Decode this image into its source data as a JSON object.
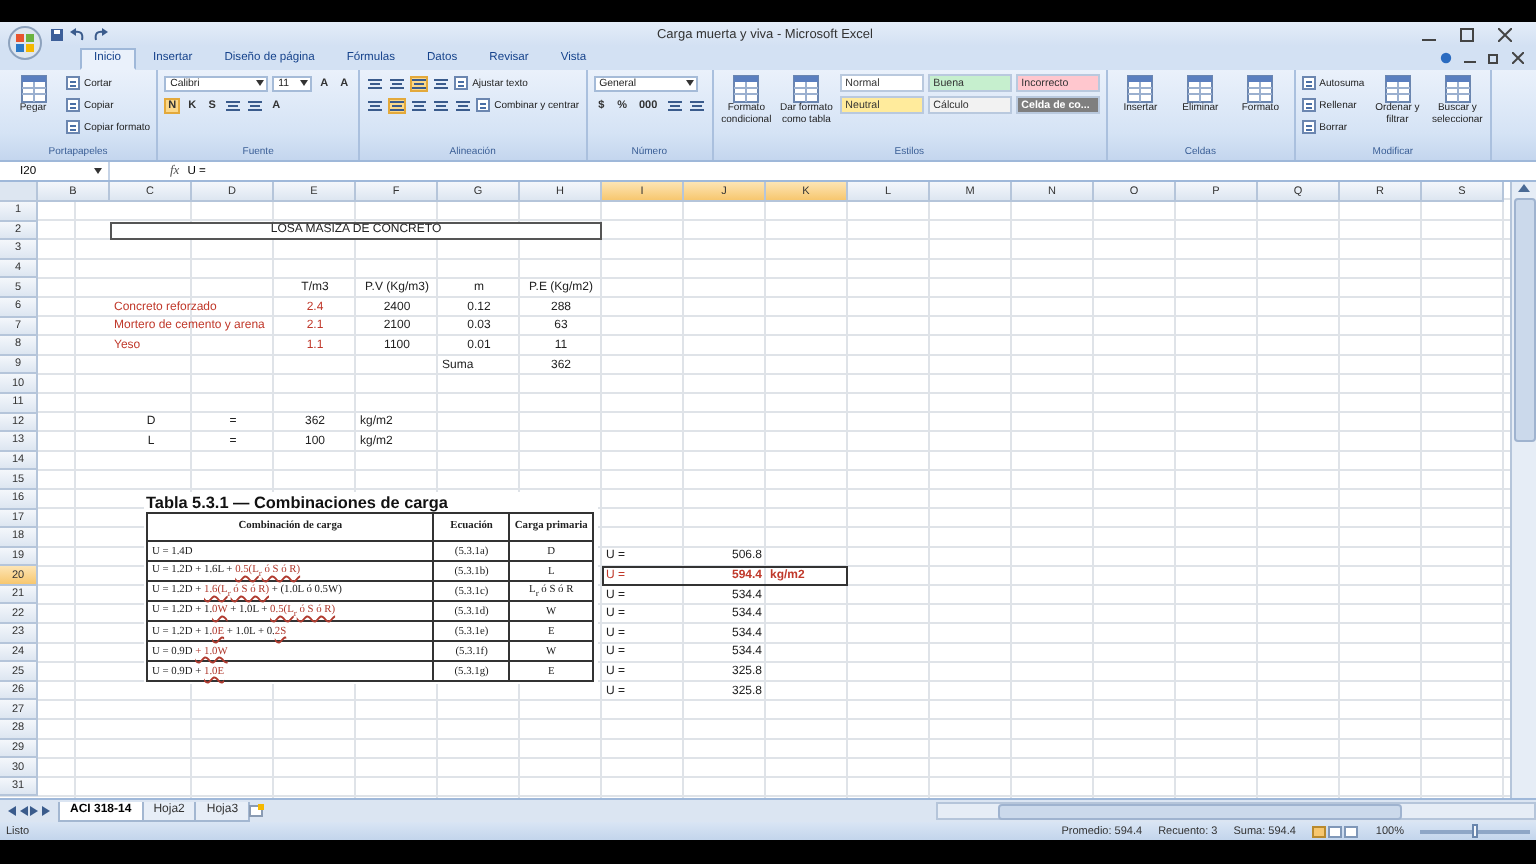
{
  "window": {
    "title": "Carga muerta y viva - Microsoft Excel"
  },
  "tabs": [
    {
      "label": "Inicio",
      "selected": true
    },
    {
      "label": "Insertar",
      "selected": false
    },
    {
      "label": "Diseño de página",
      "selected": false
    },
    {
      "label": "Fórmulas",
      "selected": false
    },
    {
      "label": "Datos",
      "selected": false
    },
    {
      "label": "Revisar",
      "selected": false
    },
    {
      "label": "Vista",
      "selected": false
    }
  ],
  "ribbon": [
    {
      "label": "Portapapeles",
      "blocks": [
        {
          "kind": "large",
          "label": "Pegar"
        },
        {
          "kind": "stack",
          "lines": [
            [
              {
                "kind": "small",
                "label": "Cortar"
              }
            ],
            [
              {
                "kind": "small",
                "label": "Copiar"
              }
            ],
            [
              {
                "kind": "small",
                "label": "Copiar formato"
              }
            ]
          ]
        }
      ]
    },
    {
      "label": "Fuente",
      "blocks": [
        {
          "kind": "stack",
          "lines": [
            [
              {
                "kind": "field",
                "value": "Calibri"
              },
              {
                "kind": "field",
                "value": "11"
              },
              {
                "kind": "glyph",
                "label": "A",
                "on": false
              },
              {
                "kind": "glyph",
                "label": "A",
                "on": false
              }
            ],
            [
              {
                "kind": "glyph",
                "label": "N",
                "on": true
              },
              {
                "kind": "glyph",
                "label": "K",
                "on": false
              },
              {
                "kind": "glyph",
                "label": "S",
                "on": false
              },
              {
                "kind": "icon",
                "on": false
              },
              {
                "kind": "icon",
                "on": false
              },
              {
                "kind": "glyph",
                "label": "A",
                "on": false
              }
            ]
          ]
        }
      ]
    },
    {
      "label": "Alineación",
      "blocks": [
        {
          "kind": "stack",
          "lines": [
            [
              {
                "kind": "icon",
                "on": false
              },
              {
                "kind": "icon",
                "on": false
              },
              {
                "kind": "icon",
                "on": true
              },
              {
                "kind": "icon",
                "on": false
              },
              {
                "kind": "small",
                "label": "Ajustar texto"
              }
            ],
            [
              {
                "kind": "icon",
                "on": false
              },
              {
                "kind": "icon",
                "on": true
              },
              {
                "kind": "icon",
                "on": false
              },
              {
                "kind": "icon",
                "on": false
              },
              {
                "kind": "icon",
                "on": false
              },
              {
                "kind": "small",
                "label": "Combinar y centrar"
              }
            ]
          ]
        }
      ]
    },
    {
      "label": "Número",
      "blocks": [
        {
          "kind": "stack",
          "lines": [
            [
              {
                "kind": "field",
                "value": "General"
              }
            ],
            [
              {
                "kind": "glyph",
                "label": "$",
                "on": false
              },
              {
                "kind": "glyph",
                "label": "%",
                "on": false
              },
              {
                "kind": "glyph",
                "label": "000",
                "on": false
              },
              {
                "kind": "icon",
                "on": false
              },
              {
                "kind": "icon",
                "on": false
              }
            ]
          ]
        }
      ]
    },
    {
      "label": "Estilos",
      "blocks": [
        {
          "kind": "large",
          "label": "Formato condicional"
        },
        {
          "kind": "large",
          "label": "Dar formato como tabla"
        },
        {
          "kind": "stack",
          "lines": [
            [
              {
                "kind": "style",
                "label": "Normal",
                "color": "#ffffff"
              },
              {
                "kind": "style",
                "label": "Buena",
                "color": "#c6efce"
              },
              {
                "kind": "style",
                "label": "Incorrecto",
                "color": "#ffc7ce"
              }
            ],
            [
              {
                "kind": "style",
                "label": "Neutral",
                "color": "#ffeb9c"
              },
              {
                "kind": "style",
                "label": "Cálculo",
                "color": "#f2f2f2"
              },
              {
                "kind": "style",
                "label": "Celda de co...",
                "color": "#7f7f7f"
              }
            ]
          ]
        }
      ]
    },
    {
      "label": "Celdas",
      "blocks": [
        {
          "kind": "large",
          "label": "Insertar"
        },
        {
          "kind": "large",
          "label": "Eliminar"
        },
        {
          "kind": "large",
          "label": "Formato"
        }
      ]
    },
    {
      "label": "Modificar",
      "blocks": [
        {
          "kind": "stack",
          "lines": [
            [
              {
                "kind": "small",
                "label": "Autosuma"
              }
            ],
            [
              {
                "kind": "small",
                "label": "Rellenar"
              }
            ],
            [
              {
                "kind": "small",
                "label": "Borrar"
              }
            ]
          ]
        },
        {
          "kind": "large",
          "label": "Ordenar y filtrar"
        },
        {
          "kind": "large",
          "label": "Buscar y seleccionar"
        }
      ]
    }
  ],
  "formula_bar": {
    "cell": "I20",
    "function_label": "fx",
    "formula": "U ="
  },
  "columns": [
    {
      "letter": "B",
      "selected": false
    },
    {
      "letter": "C",
      "selected": false
    },
    {
      "letter": "D",
      "selected": false
    },
    {
      "letter": "E",
      "selected": false
    },
    {
      "letter": "F",
      "selected": false
    },
    {
      "letter": "G",
      "selected": false
    },
    {
      "letter": "H",
      "selected": false
    },
    {
      "letter": "I",
      "selected": true
    },
    {
      "letter": "J",
      "selected": true
    },
    {
      "letter": "K",
      "selected": true
    },
    {
      "letter": "L",
      "selected": false
    },
    {
      "letter": "M",
      "selected": false
    },
    {
      "letter": "N",
      "selected": false
    },
    {
      "letter": "O",
      "selected": false
    },
    {
      "letter": "P",
      "selected": false
    },
    {
      "letter": "Q",
      "selected": false
    },
    {
      "letter": "R",
      "selected": false
    },
    {
      "letter": "S",
      "selected": false
    }
  ],
  "rows": [
    {
      "number": "1",
      "selected": false
    },
    {
      "number": "2",
      "selected": false,
      "cells": [
        "",
        {
          "value": "LOSA MASIZA DE CONCRETO",
          "kind": "title",
          "colspan": 6,
          "selected": false,
          "bold": false
        }
      ]
    },
    {
      "number": "3",
      "selected": false
    },
    {
      "number": "4",
      "selected": false
    },
    {
      "number": "5",
      "selected": false,
      "cells": [
        "",
        "",
        "",
        {
          "value": "T/m3",
          "kind": "value",
          "selected": false,
          "bold": false
        },
        {
          "value": "P.V (Kg/m3)",
          "kind": "value",
          "selected": false,
          "bold": false
        },
        {
          "value": "m",
          "kind": "value",
          "selected": false,
          "bold": false
        },
        {
          "value": "P.E (Kg/m2)",
          "kind": "value",
          "selected": false,
          "bold": false
        }
      ]
    },
    {
      "number": "6",
      "selected": false,
      "cells": [
        "",
        {
          "value": "Concreto reforzado",
          "kind": "label",
          "color": "#c0392b",
          "selected": false,
          "bold": false
        },
        "",
        {
          "value": "2.4",
          "kind": "value",
          "color": "#c0392b",
          "selected": false,
          "bold": false
        },
        {
          "value": "2400",
          "kind": "value",
          "selected": false,
          "bold": false
        },
        {
          "value": "0.12",
          "kind": "value",
          "selected": false,
          "bold": false
        },
        {
          "value": "288",
          "kind": "value",
          "selected": false,
          "bold": false
        }
      ]
    },
    {
      "number": "7",
      "selected": false,
      "cells": [
        "",
        {
          "value": "Mortero de cemento y arena",
          "kind": "label",
          "color": "#c0392b",
          "selected": false,
          "bold": false
        },
        "",
        {
          "value": "2.1",
          "kind": "value",
          "color": "#c0392b",
          "selected": false,
          "bold": false
        },
        {
          "value": "2100",
          "kind": "value",
          "selected": false,
          "bold": false
        },
        {
          "value": "0.03",
          "kind": "value",
          "selected": false,
          "bold": false
        },
        {
          "value": "63",
          "kind": "value",
          "selected": false,
          "bold": false
        }
      ]
    },
    {
      "number": "8",
      "selected": false,
      "cells": [
        "",
        {
          "value": "Yeso",
          "kind": "label",
          "color": "#c0392b",
          "selected": false,
          "bold": false
        },
        "",
        {
          "value": "1.1",
          "kind": "value",
          "color": "#c0392b",
          "selected": false,
          "bold": false
        },
        {
          "value": "1100",
          "kind": "value",
          "selected": false,
          "bold": false
        },
        {
          "value": "0.01",
          "kind": "value",
          "selected": false,
          "bold": false
        },
        {
          "value": "11",
          "kind": "value",
          "selected": false,
          "bold": false
        }
      ]
    },
    {
      "number": "9",
      "selected": false,
      "cells": [
        "",
        "",
        "",
        "",
        "",
        {
          "value": "Suma",
          "kind": "label",
          "selected": false,
          "bold": false
        },
        {
          "value": "362",
          "kind": "value",
          "selected": false,
          "bold": false
        }
      ]
    },
    {
      "number": "10",
      "selected": false
    },
    {
      "number": "11",
      "selected": false
    },
    {
      "number": "12",
      "selected": false,
      "cells": [
        "",
        {
          "value": "D",
          "kind": "value",
          "selected": false,
          "bold": false
        },
        {
          "value": "=",
          "kind": "value",
          "selected": false,
          "bold": false
        },
        {
          "value": "362",
          "kind": "value",
          "selected": false,
          "bold": false
        },
        {
          "value": "kg/m2",
          "kind": "label",
          "selected": false,
          "bold": false
        }
      ]
    },
    {
      "number": "13",
      "selected": false,
      "cells": [
        "",
        {
          "value": "L",
          "kind": "value",
          "selected": false,
          "bold": false
        },
        {
          "value": "=",
          "kind": "value",
          "selected": false,
          "bold": false
        },
        {
          "value": "100",
          "kind": "value",
          "selected": false,
          "bold": false
        },
        {
          "value": "kg/m2",
          "kind": "label",
          "selected": false,
          "bold": false
        }
      ]
    },
    {
      "number": "14",
      "selected": false
    },
    {
      "number": "15",
      "selected": false
    },
    {
      "number": "16",
      "selected": false
    },
    {
      "number": "17",
      "selected": false
    },
    {
      "number": "18",
      "selected": false
    },
    {
      "number": "19",
      "selected": false,
      "cells": [
        "",
        "",
        "",
        "",
        "",
        "",
        "",
        {
          "value": "U =",
          "kind": "label",
          "selected": false,
          "bold": false
        },
        {
          "value": "506.8",
          "kind": "number",
          "selected": false,
          "bold": false
        }
      ]
    },
    {
      "number": "20",
      "selected": true,
      "cells": [
        "",
        "",
        "",
        "",
        "",
        "",
        "",
        {
          "value": "U =",
          "kind": "label",
          "color": "#c0392b",
          "selected": true,
          "bold": false
        },
        {
          "value": "594.4",
          "kind": "number",
          "color": "#c0392b",
          "selected": true,
          "bold": true
        },
        {
          "value": "kg/m2",
          "kind": "label",
          "color": "#c0392b",
          "selected": true,
          "bold": true
        }
      ]
    },
    {
      "number": "21",
      "selected": false,
      "cells": [
        "",
        "",
        "",
        "",
        "",
        "",
        "",
        {
          "value": "U =",
          "kind": "label",
          "selected": false,
          "bold": false
        },
        {
          "value": "534.4",
          "kind": "number",
          "selected": false,
          "bold": false
        }
      ]
    },
    {
      "number": "22",
      "selected": false,
      "cells": [
        "",
        "",
        "",
        "",
        "",
        "",
        "",
        {
          "value": "U =",
          "kind": "label",
          "selected": false,
          "bold": false
        },
        {
          "value": "534.4",
          "kind": "number",
          "selected": false,
          "bold": false
        }
      ]
    },
    {
      "number": "23",
      "selected": false,
      "cells": [
        "",
        "",
        "",
        "",
        "",
        "",
        "",
        {
          "value": "U =",
          "kind": "label",
          "selected": false,
          "bold": false
        },
        {
          "value": "534.4",
          "kind": "number",
          "selected": false,
          "bold": false
        }
      ]
    },
    {
      "number": "24",
      "selected": false,
      "cells": [
        "",
        "",
        "",
        "",
        "",
        "",
        "",
        {
          "value": "U =",
          "kind": "label",
          "selected": false,
          "bold": false
        },
        {
          "value": "534.4",
          "kind": "number",
          "selected": false,
          "bold": false
        }
      ]
    },
    {
      "number": "25",
      "selected": false,
      "cells": [
        "",
        "",
        "",
        "",
        "",
        "",
        "",
        {
          "value": "U =",
          "kind": "label",
          "selected": false,
          "bold": false
        },
        {
          "value": "325.8",
          "kind": "number",
          "selected": false,
          "bold": false
        }
      ]
    },
    {
      "number": "26",
      "selected": false,
      "cells": [
        "",
        "",
        "",
        "",
        "",
        "",
        "",
        {
          "value": "U =",
          "kind": "label",
          "selected": false,
          "bold": false
        },
        {
          "value": "325.8",
          "kind": "number",
          "selected": false,
          "bold": false
        }
      ]
    },
    {
      "number": "27",
      "selected": false
    },
    {
      "number": "28",
      "selected": false
    },
    {
      "number": "29",
      "selected": false
    },
    {
      "number": "30",
      "selected": false
    },
    {
      "number": "31",
      "selected": false
    }
  ],
  "figure": {
    "title": "Tabla 5.3.1 — Combinaciones de carga",
    "columns": [
      "Combinación de carga",
      "Ecuación",
      "Carga primaria"
    ],
    "rows": [
      {
        "formula": [
          {
            "text": "U = 1.4D",
            "struck": false
          }
        ],
        "equation": "(5.3.1a)",
        "load": "D"
      },
      {
        "formula": [
          {
            "text": "U = 1.2D + 1.6L + ",
            "struck": false
          },
          {
            "text": "0.5(L$_{r}$ ó S ó R)",
            "struck": true
          }
        ],
        "equation": "(5.3.1b)",
        "load": "L"
      },
      {
        "formula": [
          {
            "text": "U = 1.2D + ",
            "struck": false
          },
          {
            "text": "1.6(L$_{r}$ ó S ó R)",
            "struck": true
          },
          {
            "text": " + (1.0L ó 0.5W)",
            "struck": false
          }
        ],
        "equation": "(5.3.1c)",
        "load": "L$_{r}$ ó S ó R"
      },
      {
        "formula": [
          {
            "text": "U = 1.2D + 1.",
            "struck": false
          },
          {
            "text": "0W",
            "struck": true
          },
          {
            "text": " + 1.0L + ",
            "struck": false
          },
          {
            "text": "0.5(L$_{r}$ ó S ó R)",
            "struck": true
          }
        ],
        "equation": "(5.3.1d)",
        "load": "W"
      },
      {
        "formula": [
          {
            "text": "U = 1.2D + 1.",
            "struck": false
          },
          {
            "text": "0E",
            "struck": true
          },
          {
            "text": " + 1.0L + 0.",
            "struck": false
          },
          {
            "text": "2S",
            "struck": true
          }
        ],
        "equation": "(5.3.1e)",
        "load": "E"
      },
      {
        "formula": [
          {
            "text": "U = 0.9D ",
            "struck": false
          },
          {
            "text": "+ 1.0W",
            "struck": true
          }
        ],
        "equation": "(5.3.1f)",
        "load": "W"
      },
      {
        "formula": [
          {
            "text": "U = 0.9D + ",
            "struck": false
          },
          {
            "text": "1.0E",
            "struck": true
          }
        ],
        "equation": "(5.3.1g)",
        "load": "E"
      }
    ]
  },
  "sheet_tabs": [
    {
      "label": "ACI 318-14",
      "selected": true
    },
    {
      "label": "Hoja2",
      "selected": false
    },
    {
      "label": "Hoja3",
      "selected": false
    }
  ],
  "status_bar": {
    "state": "Listo",
    "stats": [
      "Promedio: 594.4",
      "Recuento: 3",
      "Suma: 594.4"
    ],
    "zoom": {
      "label": "100%",
      "level": 0.5
    }
  }
}
